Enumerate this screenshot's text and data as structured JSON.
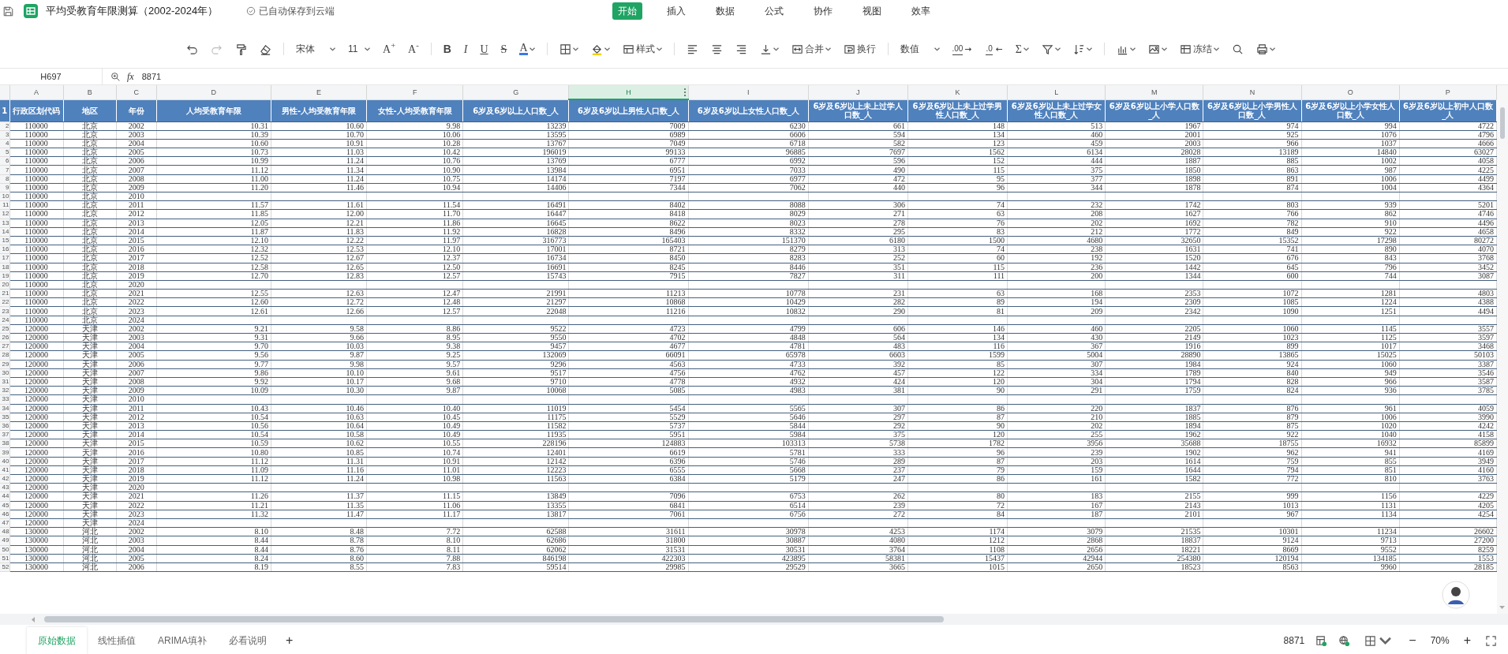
{
  "app": {
    "title": "平均受教育年限测算（2002-2024年）",
    "save_status": "已自动保存到云端"
  },
  "menu": [
    {
      "label": "开始",
      "selected": true
    },
    {
      "label": "插入",
      "selected": false
    },
    {
      "label": "数据",
      "selected": false
    },
    {
      "label": "公式",
      "selected": false
    },
    {
      "label": "协作",
      "selected": false
    },
    {
      "label": "视图",
      "selected": false
    },
    {
      "label": "效率",
      "selected": false
    }
  ],
  "history": [
    {
      "kind": "undo",
      "disabled": false
    },
    {
      "kind": "redo",
      "disabled": true
    }
  ],
  "toolbar": [
    {
      "kind": "painter"
    },
    {
      "kind": "eraser"
    },
    {
      "kind": "sep"
    },
    {
      "kind": "font",
      "label": "宋体"
    },
    {
      "kind": "size",
      "label": "11"
    },
    {
      "kind": "grow",
      "glyph": "A$^{+}$"
    },
    {
      "kind": "shrink",
      "glyph": "A$^{-}$"
    },
    {
      "kind": "sep"
    },
    {
      "kind": "bold",
      "glyph": "B"
    },
    {
      "kind": "italic",
      "glyph": "I"
    },
    {
      "kind": "underline",
      "glyph": "U"
    },
    {
      "kind": "strike",
      "glyph": "S"
    },
    {
      "kind": "fontcolor",
      "glyph": "A"
    },
    {
      "kind": "sep"
    },
    {
      "kind": "border"
    },
    {
      "kind": "fill"
    },
    {
      "kind": "style",
      "label": "样式"
    },
    {
      "kind": "sep"
    },
    {
      "kind": "alignleft"
    },
    {
      "kind": "aligncenter"
    },
    {
      "kind": "alignright"
    },
    {
      "kind": "valign"
    },
    {
      "kind": "merge",
      "label": "合并"
    },
    {
      "kind": "wrap",
      "label": "换行"
    },
    {
      "kind": "sep"
    },
    {
      "kind": "format",
      "label": "数值"
    },
    {
      "kind": "incdec",
      "glyph": ".00"
    },
    {
      "kind": "decdec",
      "glyph": ".0"
    },
    {
      "kind": "sum",
      "glyph": "Σ"
    },
    {
      "kind": "filter"
    },
    {
      "kind": "sort"
    },
    {
      "kind": "sep"
    },
    {
      "kind": "chart"
    },
    {
      "kind": "image"
    },
    {
      "kind": "freeze",
      "label": "冻结"
    },
    {
      "kind": "search"
    },
    {
      "kind": "print"
    }
  ],
  "formula_bar": {
    "cell": "H697",
    "fx": "fx",
    "value": "8871"
  },
  "sheet": {
    "columns": [
      {
        "letter": "A",
        "header": "行政区划代码",
        "selected": false
      },
      {
        "letter": "B",
        "header": "地区",
        "selected": false
      },
      {
        "letter": "C",
        "header": "年份",
        "selected": false
      },
      {
        "letter": "D",
        "header": "人均受教育年限",
        "selected": false
      },
      {
        "letter": "E",
        "header": "男性-人均受教育年限",
        "selected": false
      },
      {
        "letter": "F",
        "header": "女性-人均受教育年限",
        "selected": false
      },
      {
        "letter": "G",
        "header": "6岁及6岁以上人口数_人",
        "selected": false
      },
      {
        "letter": "H",
        "header": "6岁及6岁以上男性人口数_人",
        "selected": true
      },
      {
        "letter": "I",
        "header": "6岁及6岁以上女性人口数_人",
        "selected": false
      },
      {
        "letter": "J",
        "header": "6岁及6岁以上未上过学人口数_人",
        "selected": false
      },
      {
        "letter": "K",
        "header": "6岁及6岁以上未上过学男性人口数_人",
        "selected": false
      },
      {
        "letter": "L",
        "header": "6岁及6岁以上未上过学女性人口数_人",
        "selected": false
      },
      {
        "letter": "M",
        "header": "6岁及6岁以上小学人口数_人",
        "selected": false
      },
      {
        "letter": "N",
        "header": "6岁及6岁以上小学男性人口数_人",
        "selected": false
      },
      {
        "letter": "O",
        "header": "6岁及6岁以上小学女性人口数_人",
        "selected": false
      },
      {
        "letter": "P",
        "header": "6岁及6岁以上初中人口数_人",
        "selected": false
      }
    ],
    "header_row": "1",
    "rows": [
      {
        "n": "2",
        "cells": [
          "110000",
          "北京",
          "2002",
          "10.31",
          "10.60",
          "9.98",
          "13239",
          "7009",
          "6230",
          "661",
          "148",
          "513",
          "1967",
          "974",
          "994",
          "4722"
        ]
      },
      {
        "n": "3",
        "cells": [
          "110000",
          "北京",
          "2003",
          "10.39",
          "10.70",
          "10.06",
          "13595",
          "6989",
          "6606",
          "594",
          "134",
          "460",
          "2001",
          "925",
          "1076",
          "4796"
        ]
      },
      {
        "n": "4",
        "cells": [
          "110000",
          "北京",
          "2004",
          "10.60",
          "10.91",
          "10.28",
          "13767",
          "7049",
          "6718",
          "582",
          "123",
          "459",
          "2003",
          "966",
          "1037",
          "4666"
        ]
      },
      {
        "n": "5",
        "cells": [
          "110000",
          "北京",
          "2005",
          "10.73",
          "11.03",
          "10.42",
          "196019",
          "99133",
          "96885",
          "7697",
          "1562",
          "6134",
          "28028",
          "13189",
          "14840",
          "63027"
        ]
      },
      {
        "n": "6",
        "cells": [
          "110000",
          "北京",
          "2006",
          "10.99",
          "11.24",
          "10.76",
          "13769",
          "6777",
          "6992",
          "596",
          "152",
          "444",
          "1887",
          "885",
          "1002",
          "4058"
        ]
      },
      {
        "n": "7",
        "cells": [
          "110000",
          "北京",
          "2007",
          "11.12",
          "11.34",
          "10.90",
          "13984",
          "6951",
          "7033",
          "490",
          "115",
          "375",
          "1850",
          "863",
          "987",
          "4225"
        ]
      },
      {
        "n": "8",
        "cells": [
          "110000",
          "北京",
          "2008",
          "11.00",
          "11.24",
          "10.75",
          "14174",
          "7197",
          "6977",
          "472",
          "95",
          "377",
          "1898",
          "891",
          "1006",
          "4499"
        ]
      },
      {
        "n": "9",
        "cells": [
          "110000",
          "北京",
          "2009",
          "11.20",
          "11.46",
          "10.94",
          "14406",
          "7344",
          "7062",
          "440",
          "96",
          "344",
          "1878",
          "874",
          "1004",
          "4364"
        ]
      },
      {
        "n": "10",
        "cells": [
          "110000",
          "北京",
          "2010"
        ]
      },
      {
        "n": "11",
        "cells": [
          "110000",
          "北京",
          "2011",
          "11.57",
          "11.61",
          "11.54",
          "16491",
          "8402",
          "8088",
          "306",
          "74",
          "232",
          "1742",
          "803",
          "939",
          "5201"
        ]
      },
      {
        "n": "12",
        "cells": [
          "110000",
          "北京",
          "2012",
          "11.85",
          "12.00",
          "11.70",
          "16447",
          "8418",
          "8029",
          "271",
          "63",
          "208",
          "1627",
          "766",
          "862",
          "4746"
        ]
      },
      {
        "n": "13",
        "cells": [
          "110000",
          "北京",
          "2013",
          "12.05",
          "12.21",
          "11.86",
          "16645",
          "8622",
          "8023",
          "278",
          "76",
          "202",
          "1692",
          "782",
          "910",
          "4496"
        ]
      },
      {
        "n": "14",
        "cells": [
          "110000",
          "北京",
          "2014",
          "11.87",
          "11.83",
          "11.92",
          "16828",
          "8496",
          "8332",
          "295",
          "83",
          "212",
          "1772",
          "849",
          "922",
          "4658"
        ]
      },
      {
        "n": "15",
        "cells": [
          "110000",
          "北京",
          "2015",
          "12.10",
          "12.22",
          "11.97",
          "316773",
          "165403",
          "151370",
          "6180",
          "1500",
          "4680",
          "32650",
          "15352",
          "17298",
          "80272"
        ]
      },
      {
        "n": "16",
        "cells": [
          "110000",
          "北京",
          "2016",
          "12.32",
          "12.53",
          "12.10",
          "17001",
          "8721",
          "8279",
          "313",
          "74",
          "238",
          "1631",
          "741",
          "890",
          "4070"
        ]
      },
      {
        "n": "17",
        "cells": [
          "110000",
          "北京",
          "2017",
          "12.52",
          "12.67",
          "12.37",
          "16734",
          "8450",
          "8283",
          "252",
          "60",
          "192",
          "1520",
          "676",
          "843",
          "3768"
        ]
      },
      {
        "n": "18",
        "cells": [
          "110000",
          "北京",
          "2018",
          "12.58",
          "12.65",
          "12.50",
          "16691",
          "8245",
          "8446",
          "351",
          "115",
          "236",
          "1442",
          "645",
          "796",
          "3452"
        ]
      },
      {
        "n": "19",
        "cells": [
          "110000",
          "北京",
          "2019",
          "12.70",
          "12.83",
          "12.57",
          "15743",
          "7915",
          "7827",
          "311",
          "111",
          "200",
          "1344",
          "600",
          "744",
          "3087"
        ]
      },
      {
        "n": "20",
        "cells": [
          "110000",
          "北京",
          "2020"
        ]
      },
      {
        "n": "21",
        "cells": [
          "110000",
          "北京",
          "2021",
          "12.55",
          "12.63",
          "12.47",
          "21991",
          "11213",
          "10778",
          "231",
          "63",
          "168",
          "2353",
          "1072",
          "1281",
          "4803"
        ]
      },
      {
        "n": "22",
        "cells": [
          "110000",
          "北京",
          "2022",
          "12.60",
          "12.72",
          "12.48",
          "21297",
          "10868",
          "10429",
          "282",
          "89",
          "194",
          "2309",
          "1085",
          "1224",
          "4388"
        ]
      },
      {
        "n": "23",
        "cells": [
          "110000",
          "北京",
          "2023",
          "12.61",
          "12.66",
          "12.57",
          "22048",
          "11216",
          "10832",
          "290",
          "81",
          "209",
          "2342",
          "1090",
          "1251",
          "4494"
        ]
      },
      {
        "n": "24",
        "cells": [
          "110000",
          "北京",
          "2024"
        ]
      },
      {
        "n": "25",
        "cells": [
          "120000",
          "天津",
          "2002",
          "9.21",
          "9.58",
          "8.86",
          "9522",
          "4723",
          "4799",
          "606",
          "146",
          "460",
          "2205",
          "1060",
          "1145",
          "3557"
        ]
      },
      {
        "n": "26",
        "cells": [
          "120000",
          "天津",
          "2003",
          "9.31",
          "9.66",
          "8.95",
          "9550",
          "4702",
          "4848",
          "564",
          "134",
          "430",
          "2149",
          "1023",
          "1125",
          "3597"
        ]
      },
      {
        "n": "27",
        "cells": [
          "120000",
          "天津",
          "2004",
          "9.70",
          "10.03",
          "9.38",
          "9457",
          "4677",
          "4781",
          "483",
          "116",
          "367",
          "1916",
          "899",
          "1017",
          "3468"
        ]
      },
      {
        "n": "28",
        "cells": [
          "120000",
          "天津",
          "2005",
          "9.56",
          "9.87",
          "9.25",
          "132069",
          "66091",
          "65978",
          "6603",
          "1599",
          "5004",
          "28890",
          "13865",
          "15025",
          "50103"
        ]
      },
      {
        "n": "29",
        "cells": [
          "120000",
          "天津",
          "2006",
          "9.77",
          "9.98",
          "9.57",
          "9296",
          "4563",
          "4733",
          "392",
          "85",
          "307",
          "1984",
          "924",
          "1060",
          "3387"
        ]
      },
      {
        "n": "30",
        "cells": [
          "120000",
          "天津",
          "2007",
          "9.86",
          "10.10",
          "9.61",
          "9517",
          "4756",
          "4762",
          "457",
          "122",
          "334",
          "1789",
          "840",
          "949",
          "3546"
        ]
      },
      {
        "n": "31",
        "cells": [
          "120000",
          "天津",
          "2008",
          "9.92",
          "10.17",
          "9.68",
          "9710",
          "4778",
          "4932",
          "424",
          "120",
          "304",
          "1794",
          "828",
          "966",
          "3587"
        ]
      },
      {
        "n": "32",
        "cells": [
          "120000",
          "天津",
          "2009",
          "10.09",
          "10.30",
          "9.87",
          "10068",
          "5085",
          "4983",
          "381",
          "90",
          "291",
          "1759",
          "824",
          "936",
          "3785"
        ]
      },
      {
        "n": "33",
        "cells": [
          "120000",
          "天津",
          "2010"
        ]
      },
      {
        "n": "34",
        "cells": [
          "120000",
          "天津",
          "2011",
          "10.43",
          "10.46",
          "10.40",
          "11019",
          "5454",
          "5565",
          "307",
          "86",
          "220",
          "1837",
          "876",
          "961",
          "4059"
        ]
      },
      {
        "n": "35",
        "cells": [
          "120000",
          "天津",
          "2012",
          "10.54",
          "10.63",
          "10.45",
          "11175",
          "5529",
          "5646",
          "297",
          "87",
          "210",
          "1885",
          "879",
          "1006",
          "3990"
        ]
      },
      {
        "n": "36",
        "cells": [
          "120000",
          "天津",
          "2013",
          "10.56",
          "10.64",
          "10.49",
          "11582",
          "5737",
          "5844",
          "292",
          "90",
          "202",
          "1894",
          "875",
          "1020",
          "4242"
        ]
      },
      {
        "n": "37",
        "cells": [
          "120000",
          "天津",
          "2014",
          "10.54",
          "10.58",
          "10.49",
          "11935",
          "5951",
          "5984",
          "375",
          "120",
          "255",
          "1962",
          "922",
          "1040",
          "4158"
        ]
      },
      {
        "n": "38",
        "cells": [
          "120000",
          "天津",
          "2015",
          "10.59",
          "10.62",
          "10.55",
          "228196",
          "124883",
          "103313",
          "5738",
          "1782",
          "3956",
          "35688",
          "18755",
          "16932",
          "85899"
        ]
      },
      {
        "n": "39",
        "cells": [
          "120000",
          "天津",
          "2016",
          "10.80",
          "10.85",
          "10.74",
          "12401",
          "6619",
          "5781",
          "333",
          "96",
          "239",
          "1902",
          "962",
          "941",
          "4169"
        ]
      },
      {
        "n": "40",
        "cells": [
          "120000",
          "天津",
          "2017",
          "11.12",
          "11.31",
          "10.91",
          "12142",
          "6396",
          "5746",
          "289",
          "87",
          "203",
          "1614",
          "759",
          "855",
          "3949"
        ]
      },
      {
        "n": "41",
        "cells": [
          "120000",
          "天津",
          "2018",
          "11.09",
          "11.16",
          "11.01",
          "12223",
          "6555",
          "5668",
          "237",
          "79",
          "159",
          "1644",
          "794",
          "851",
          "4160"
        ]
      },
      {
        "n": "42",
        "cells": [
          "120000",
          "天津",
          "2019",
          "11.12",
          "11.24",
          "10.98",
          "11563",
          "6384",
          "5179",
          "247",
          "86",
          "161",
          "1582",
          "772",
          "810",
          "3763"
        ]
      },
      {
        "n": "43",
        "cells": [
          "120000",
          "天津",
          "2020"
        ]
      },
      {
        "n": "44",
        "cells": [
          "120000",
          "天津",
          "2021",
          "11.26",
          "11.37",
          "11.15",
          "13849",
          "7096",
          "6753",
          "262",
          "80",
          "183",
          "2155",
          "999",
          "1156",
          "4229"
        ]
      },
      {
        "n": "45",
        "cells": [
          "120000",
          "天津",
          "2022",
          "11.21",
          "11.35",
          "11.06",
          "13355",
          "6841",
          "6514",
          "239",
          "72",
          "167",
          "2143",
          "1013",
          "1131",
          "4205"
        ]
      },
      {
        "n": "46",
        "cells": [
          "120000",
          "天津",
          "2023",
          "11.32",
          "11.47",
          "11.17",
          "13817",
          "7061",
          "6756",
          "272",
          "84",
          "187",
          "2101",
          "967",
          "1134",
          "4254"
        ]
      },
      {
        "n": "47",
        "cells": [
          "120000",
          "天津",
          "2024"
        ]
      },
      {
        "n": "48",
        "cells": [
          "130000",
          "河北",
          "2002",
          "8.10",
          "8.48",
          "7.72",
          "62588",
          "31611",
          "30978",
          "4253",
          "1174",
          "3079",
          "21535",
          "10301",
          "11234",
          "26602"
        ]
      },
      {
        "n": "49",
        "cells": [
          "130000",
          "河北",
          "2003",
          "8.44",
          "8.78",
          "8.10",
          "62686",
          "31800",
          "30887",
          "4080",
          "1212",
          "2868",
          "18837",
          "9124",
          "9713",
          "27200"
        ]
      },
      {
        "n": "50",
        "cells": [
          "130000",
          "河北",
          "2004",
          "8.44",
          "8.76",
          "8.11",
          "62062",
          "31531",
          "30531",
          "3764",
          "1108",
          "2656",
          "18221",
          "8669",
          "9552",
          "8259"
        ]
      },
      {
        "n": "51",
        "cells": [
          "130000",
          "河北",
          "2005",
          "8.24",
          "8.60",
          "7.88",
          "846198",
          "422303",
          "423895",
          "58381",
          "15437",
          "42944",
          "254380",
          "120194",
          "134185",
          "1553"
        ]
      },
      {
        "n": "52",
        "cells": [
          "130000",
          "河北",
          "2006",
          "8.19",
          "8.55",
          "7.83",
          "59514",
          "29985",
          "29529",
          "3665",
          "1015",
          "2650",
          "18523",
          "8563",
          "9960",
          "28185"
        ]
      }
    ]
  },
  "sheet_tabs": [
    {
      "label": "原始数据",
      "selected": true
    },
    {
      "label": "线性插值",
      "selected": false
    },
    {
      "label": "ARIMA填补",
      "selected": false
    },
    {
      "label": "必看说明",
      "selected": false
    }
  ],
  "add_sheet": "+",
  "status": {
    "sum": "8871",
    "zoom_out": "−",
    "zoom": "70%",
    "zoom_in": "+"
  }
}
